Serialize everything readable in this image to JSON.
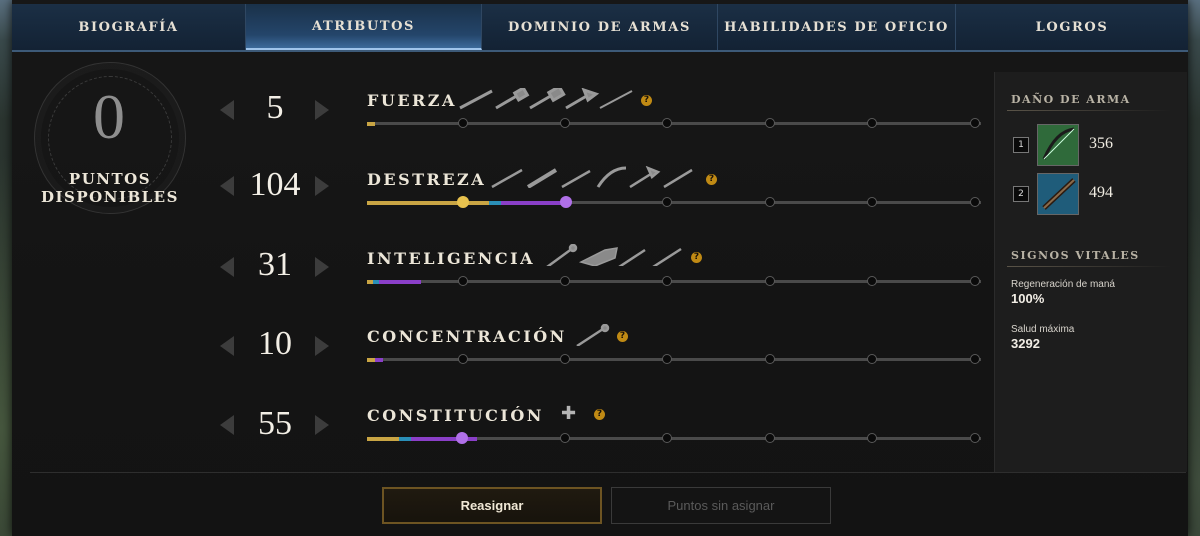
{
  "tabs": [
    {
      "label": "BIOGRAFÍA",
      "active": false
    },
    {
      "label": "ATRIBUTOS",
      "active": true
    },
    {
      "label": "DOMINIO DE ARMAS",
      "active": false
    },
    {
      "label": "HABILIDADES DE OFICIO",
      "active": false
    },
    {
      "label": "LOGROS",
      "active": false
    }
  ],
  "points": {
    "value": "0",
    "label_line1": "PUNTOS",
    "label_line2": "DISPONIBLES"
  },
  "attributes": [
    {
      "name": "FUERZA",
      "value": "5",
      "weapon_icons": [
        "sword-icon",
        "hammer-icon",
        "warhammer-icon",
        "hatchet-icon",
        "spear-icon"
      ],
      "has_help": true
    },
    {
      "name": "DESTREZA",
      "value": "104",
      "weapon_icons": [
        "spear-icon",
        "musket-icon",
        "rapier-icon",
        "bow-icon",
        "hatchet-icon",
        "sword-icon"
      ],
      "has_help": true
    },
    {
      "name": "INTELIGENCIA",
      "value": "31",
      "weapon_icons": [
        "staff-icon",
        "gauntlet-icon",
        "rapier-icon",
        "spear-icon"
      ],
      "has_help": true
    },
    {
      "name": "CONCENTRACIÓN",
      "value": "10",
      "weapon_icons": [
        "life-staff-icon"
      ],
      "has_help": true
    },
    {
      "name": "CONSTITUCIÓN",
      "value": "55",
      "weapon_icons": [
        "plus-icon"
      ],
      "has_help": true
    }
  ],
  "side": {
    "weapon_damage_title": "DAÑO DE ARMA",
    "weapons": [
      {
        "slot": "1",
        "value": "356",
        "icon": "bow-icon",
        "color": "#2f6a3a"
      },
      {
        "slot": "2",
        "value": "494",
        "icon": "musket-icon",
        "color": "#1f5c7a"
      }
    ],
    "vitals_title": "SIGNOS VITALES",
    "vitals": [
      {
        "label": "Regeneración de maná",
        "value": "100%"
      },
      {
        "label": "Salud máxima",
        "value": "3292"
      }
    ]
  },
  "buttons": {
    "reassign": "Reasignar",
    "unassigned": "Puntos sin asignar"
  },
  "colors": {
    "strength": "#c9a544",
    "dexterity": "#c9a544",
    "intelligence": "#8a3fc8",
    "focus": "#2a8fb8",
    "accent": "#6d5422"
  }
}
